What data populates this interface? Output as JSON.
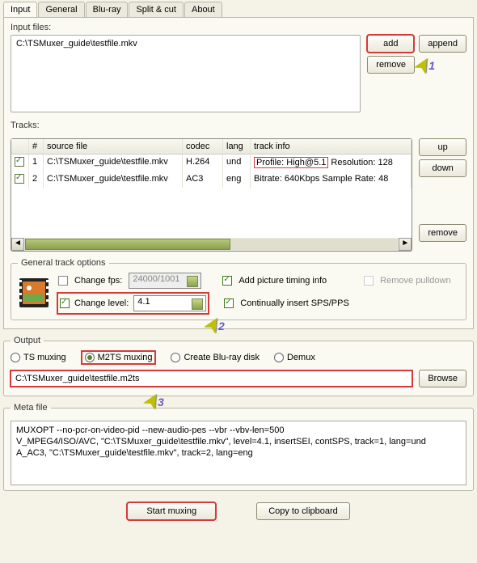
{
  "tabs": {
    "input": "Input",
    "general": "General",
    "bluray": "Blu-ray",
    "split": "Split & cut",
    "about": "About"
  },
  "input_files_label": "Input files:",
  "input_file": "C:\\TSMuxer_guide\\testfile.mkv",
  "buttons": {
    "add": "add",
    "append": "append",
    "remove": "remove",
    "up": "up",
    "down": "down",
    "browse": "Browse",
    "start": "Start muxing",
    "copy": "Copy to clipboard"
  },
  "tracks_label": "Tracks:",
  "track_headers": {
    "num": "#",
    "src": "source file",
    "codec": "codec",
    "lang": "lang",
    "info": "track info"
  },
  "tracks": [
    {
      "n": "1",
      "src": "C:\\TSMuxer_guide\\testfile.mkv",
      "codec": "H.264",
      "lang": "und",
      "profile": "Profile: High@5.1",
      "info_rest": "  Resolution: 128"
    },
    {
      "n": "2",
      "src": "C:\\TSMuxer_guide\\testfile.mkv",
      "codec": "AC3",
      "lang": "eng",
      "info": "Bitrate: 640Kbps Sample Rate: 48"
    }
  ],
  "gto": {
    "legend": "General track options",
    "change_fps": "Change fps:",
    "fps_value": "24000/1001",
    "add_picture": "Add picture timing info",
    "remove_pulldown": "Remove pulldown",
    "change_level": "Change level:",
    "level_value": "4.1",
    "cont_sps": "Continually insert SPS/PPS"
  },
  "output": {
    "legend": "Output",
    "ts": "TS muxing",
    "m2ts": "M2TS muxing",
    "bluray": "Create Blu-ray disk",
    "demux": "Demux",
    "path": "C:\\TSMuxer_guide\\testfile.m2ts"
  },
  "meta": {
    "legend": "Meta file",
    "l1": "MUXOPT --no-pcr-on-video-pid --new-audio-pes --vbr  --vbv-len=500",
    "l2": "V_MPEG4/ISO/AVC, \"C:\\TSMuxer_guide\\testfile.mkv\", level=4.1, insertSEI, contSPS, track=1, lang=und",
    "l3": "A_AC3, \"C:\\TSMuxer_guide\\testfile.mkv\", track=2, lang=eng"
  },
  "annotations": {
    "arrow": "➤",
    "a1": "1",
    "a2": "2",
    "a3": "3"
  }
}
